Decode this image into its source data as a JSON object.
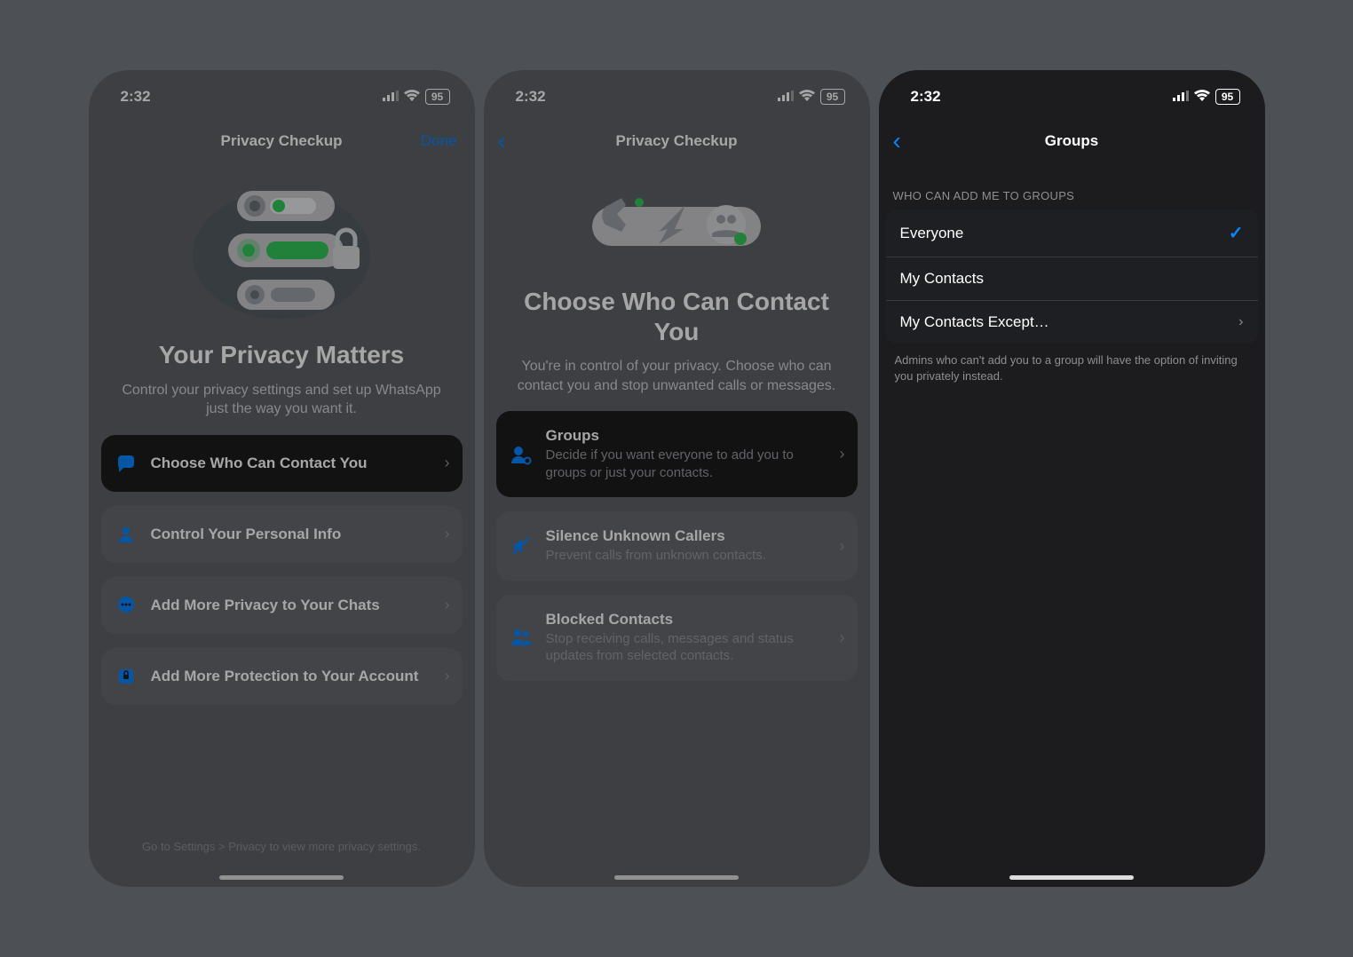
{
  "status": {
    "time": "2:32",
    "battery": "95"
  },
  "screen1": {
    "nav": {
      "title": "Privacy Checkup",
      "done": "Done"
    },
    "hero": {
      "title": "Your Privacy Matters",
      "sub": "Control your privacy settings and set up WhatsApp just the way you want it."
    },
    "cards": [
      {
        "title": "Choose Who Can Contact You"
      },
      {
        "title": "Control Your Personal Info"
      },
      {
        "title": "Add More Privacy to Your Chats"
      },
      {
        "title": "Add More Protection to Your Account"
      }
    ],
    "footer": "Go to Settings > Privacy to view more privacy settings."
  },
  "screen2": {
    "nav": {
      "title": "Privacy Checkup"
    },
    "hero": {
      "title": "Choose Who Can Contact You",
      "sub": "You're in control of your privacy. Choose who can contact you and stop unwanted calls or messages."
    },
    "cards": [
      {
        "title": "Groups",
        "sub": "Decide if you want everyone to add you to groups or just your contacts."
      },
      {
        "title": "Silence Unknown Callers",
        "sub": "Prevent calls from unknown contacts."
      },
      {
        "title": "Blocked Contacts",
        "sub": "Stop receiving calls, messages and status updates from selected contacts."
      }
    ]
  },
  "screen3": {
    "nav": {
      "title": "Groups"
    },
    "section_header": "WHO CAN ADD ME TO GROUPS",
    "options": [
      {
        "label": "Everyone",
        "selected": true
      },
      {
        "label": "My Contacts",
        "selected": false
      },
      {
        "label": "My Contacts Except…",
        "selected": false,
        "disclose": true
      }
    ],
    "section_footer": "Admins who can't add you to a group will have the option of inviting you privately instead."
  }
}
